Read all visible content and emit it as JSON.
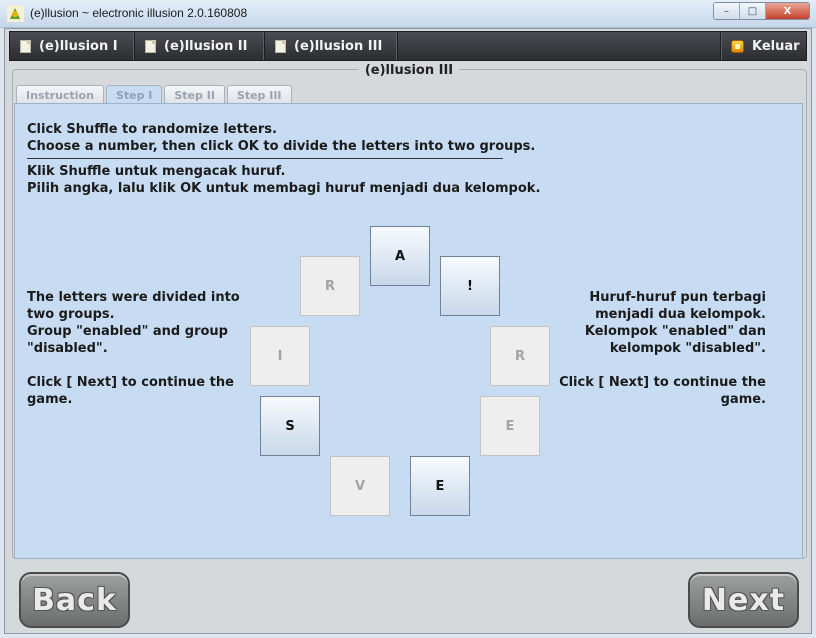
{
  "window": {
    "title": "(e)llusion ~ electronic illusion 2.0.160808",
    "controls": [
      "–",
      "□",
      "X"
    ]
  },
  "toolbar": {
    "items": [
      {
        "label": "(e)llusion I"
      },
      {
        "label": "(e)llusion II"
      },
      {
        "label": "(e)llusion III"
      }
    ],
    "exit_label": "Keluar"
  },
  "panel": {
    "title": "(e)llusion III",
    "tabs": [
      {
        "label": "Instruction",
        "active": false
      },
      {
        "label": "Step I",
        "active": true
      },
      {
        "label": "Step II",
        "active": false
      },
      {
        "label": "Step III",
        "active": false
      }
    ]
  },
  "instructions": {
    "en_line1": "Click Shuffle to randomize letters.",
    "en_line2": "Choose a number, then click OK to divide the letters into two groups.",
    "id_line1": "Klik Shuffle untuk mengacak huruf.",
    "id_line2": "Pilih angka, lalu klik OK untuk membagi huruf menjadi dua kelompok."
  },
  "left_text": {
    "line1": "The letters were divided into",
    "line2": "two groups.",
    "line3": "Group \"enabled\" and group",
    "line4": "\"disabled\".",
    "line5": "Click [ Next] to continue the",
    "line6": "game."
  },
  "right_text": {
    "line1": "Huruf-huruf pun terbagi",
    "line2": "menjadi dua kelompok.",
    "line3": "Kelompok \"enabled\" dan",
    "line4": "kelompok \"disabled\".",
    "line5": "Click [ Next] to continue the",
    "line6": "game."
  },
  "tiles": [
    {
      "letter": "A",
      "enabled": true
    },
    {
      "letter": "!",
      "enabled": true
    },
    {
      "letter": "R",
      "enabled": false
    },
    {
      "letter": "E",
      "enabled": false
    },
    {
      "letter": "E",
      "enabled": true
    },
    {
      "letter": "V",
      "enabled": false
    },
    {
      "letter": "S",
      "enabled": true
    },
    {
      "letter": "I",
      "enabled": false
    },
    {
      "letter": "R",
      "enabled": false
    }
  ],
  "nav": {
    "back_label": "Back",
    "next_label": "Next"
  },
  "colors": {
    "content_bg": "#c7dcf2",
    "toolbar_bg": "#2b2d31",
    "tile_enabled": "#c8d8ea",
    "tile_disabled": "#eeeeee"
  }
}
